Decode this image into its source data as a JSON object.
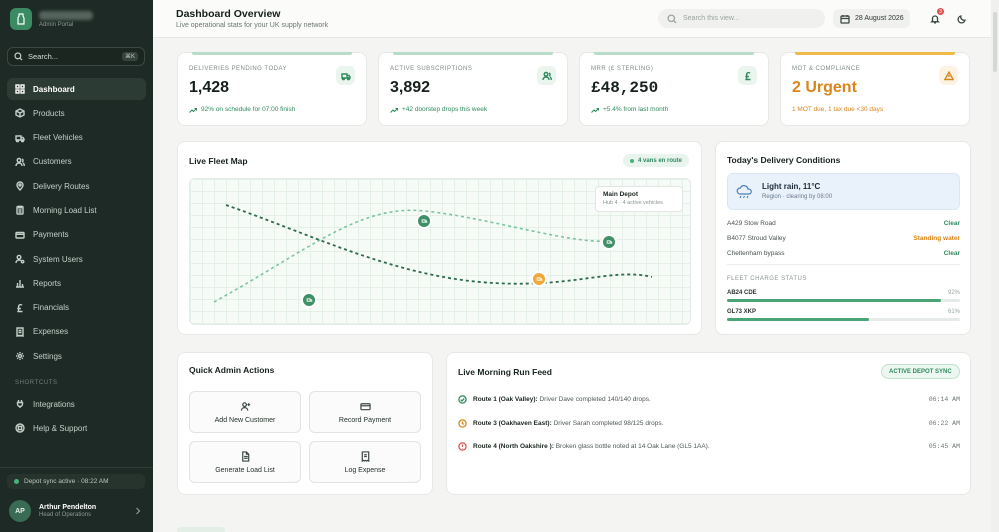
{
  "brand": {
    "subtitle": "Admin Portal"
  },
  "sidebar": {
    "search_placeholder": "Search...",
    "search_shortcut": "⌘K",
    "items": [
      {
        "label": "Dashboard",
        "icon": "grid-icon",
        "active": true
      },
      {
        "label": "Products",
        "icon": "box-icon"
      },
      {
        "label": "Fleet Vehicles",
        "icon": "truck-icon"
      },
      {
        "label": "Customers",
        "icon": "users-icon"
      },
      {
        "label": "Delivery Routes",
        "icon": "map-pin-icon"
      },
      {
        "label": "Morning Load List",
        "icon": "clipboard-icon"
      },
      {
        "label": "Payments",
        "icon": "card-icon"
      },
      {
        "label": "System Users",
        "icon": "user-cog-icon"
      },
      {
        "label": "Reports",
        "icon": "bar-chart-icon"
      },
      {
        "label": "Financials",
        "icon": "pound-icon"
      },
      {
        "label": "Expenses",
        "icon": "receipt-icon"
      },
      {
        "label": "Settings",
        "icon": "gear-icon"
      }
    ],
    "shortcuts_label": "SHORTCUTS",
    "shortcuts": [
      {
        "label": "Integrations",
        "icon": "plug-icon"
      },
      {
        "label": "Help & Support",
        "icon": "help-icon"
      }
    ],
    "sync_status": "Depot sync active · 08:22 AM",
    "user": {
      "initials": "AP",
      "name": "Arthur Pendelton",
      "role": "Head of Operations"
    }
  },
  "header": {
    "title": "Dashboard Overview",
    "subtitle": "Live operational stats for your UK supply network",
    "search_placeholder": "Search this view...",
    "date": "28 August 2026",
    "notification_count": "3"
  },
  "stats": [
    {
      "label": "DELIVERIES PENDING TODAY",
      "value": "1,428",
      "sub": "92% on schedule for 07:00 finish",
      "icon": "truck-icon"
    },
    {
      "label": "ACTIVE SUBSCRIPTIONS",
      "value": "3,892",
      "sub": "+42 doorstep drops this week",
      "icon": "users-icon"
    },
    {
      "label": "MRR (£ STERLING)",
      "value": "£48,250",
      "sub": "+5.4% from last month",
      "icon": "pound-icon"
    },
    {
      "label": "MOT & COMPLIANCE",
      "value": "2 Urgent",
      "sub": "1 MOT due, 1 tax due <30 days",
      "icon": "warning-icon"
    }
  ],
  "map": {
    "title": "Live Fleet Map",
    "badge": "4 vans en route",
    "tooltip_title": "Main Depot",
    "tooltip_sub": "Hub 4 · 4 active vehicles"
  },
  "conditions": {
    "title": "Today's Delivery Conditions",
    "weather": "Light rain, 11°C",
    "weather_sub": "Region · clearing by 08:00",
    "roads": [
      {
        "name": "A429 Stow Road",
        "status": "Clear",
        "warn": false
      },
      {
        "name": "B4077 Stroud Valley",
        "status": "Standing water",
        "warn": true
      },
      {
        "name": "Cheltenham bypass",
        "status": "Clear",
        "warn": false
      }
    ],
    "fleet_label": "FLEET CHARGE STATUS",
    "fleet": [
      {
        "name": "AB24 CDE",
        "pct": "92%",
        "value": 0.92
      },
      {
        "name": "GL73 XKP",
        "pct": "61%",
        "value": 0.61
      }
    ]
  },
  "quick": {
    "title": "Quick Admin Actions",
    "actions": [
      {
        "label": "Add New Customer",
        "icon": "user-plus-icon"
      },
      {
        "label": "Record Payment",
        "icon": "card-icon"
      },
      {
        "label": "Generate Load List",
        "icon": "document-icon"
      },
      {
        "label": "Log Expense",
        "icon": "receipt-icon"
      }
    ]
  },
  "feed": {
    "title": "Live Morning Run Feed",
    "badge": "ACTIVE DEPOT SYNC",
    "rows": [
      {
        "route": "Route 1 (Oak Valley):",
        "text": "Driver Dave completed 140/140 drops.",
        "time": "06:14 AM",
        "status": "done",
        "color": "#2f8a5e"
      },
      {
        "route": "Route 3 (Oakhaven East):",
        "text": "Driver Sarah completed 98/125 drops.",
        "time": "06:22 AM",
        "status": "progress",
        "color": "#d8851c"
      },
      {
        "route": "Route 4 (North Oakshire ):",
        "text": "Broken glass bottle noted at 14 Oak Lane (GL5 1AA).",
        "time": "05:45 AM",
        "status": "alert",
        "color": "#d9534f"
      }
    ]
  },
  "colors": {
    "accent": "#2f8a5e",
    "warning": "#d8851c",
    "danger": "#d9534f",
    "sidebar": "#1e2a25"
  }
}
